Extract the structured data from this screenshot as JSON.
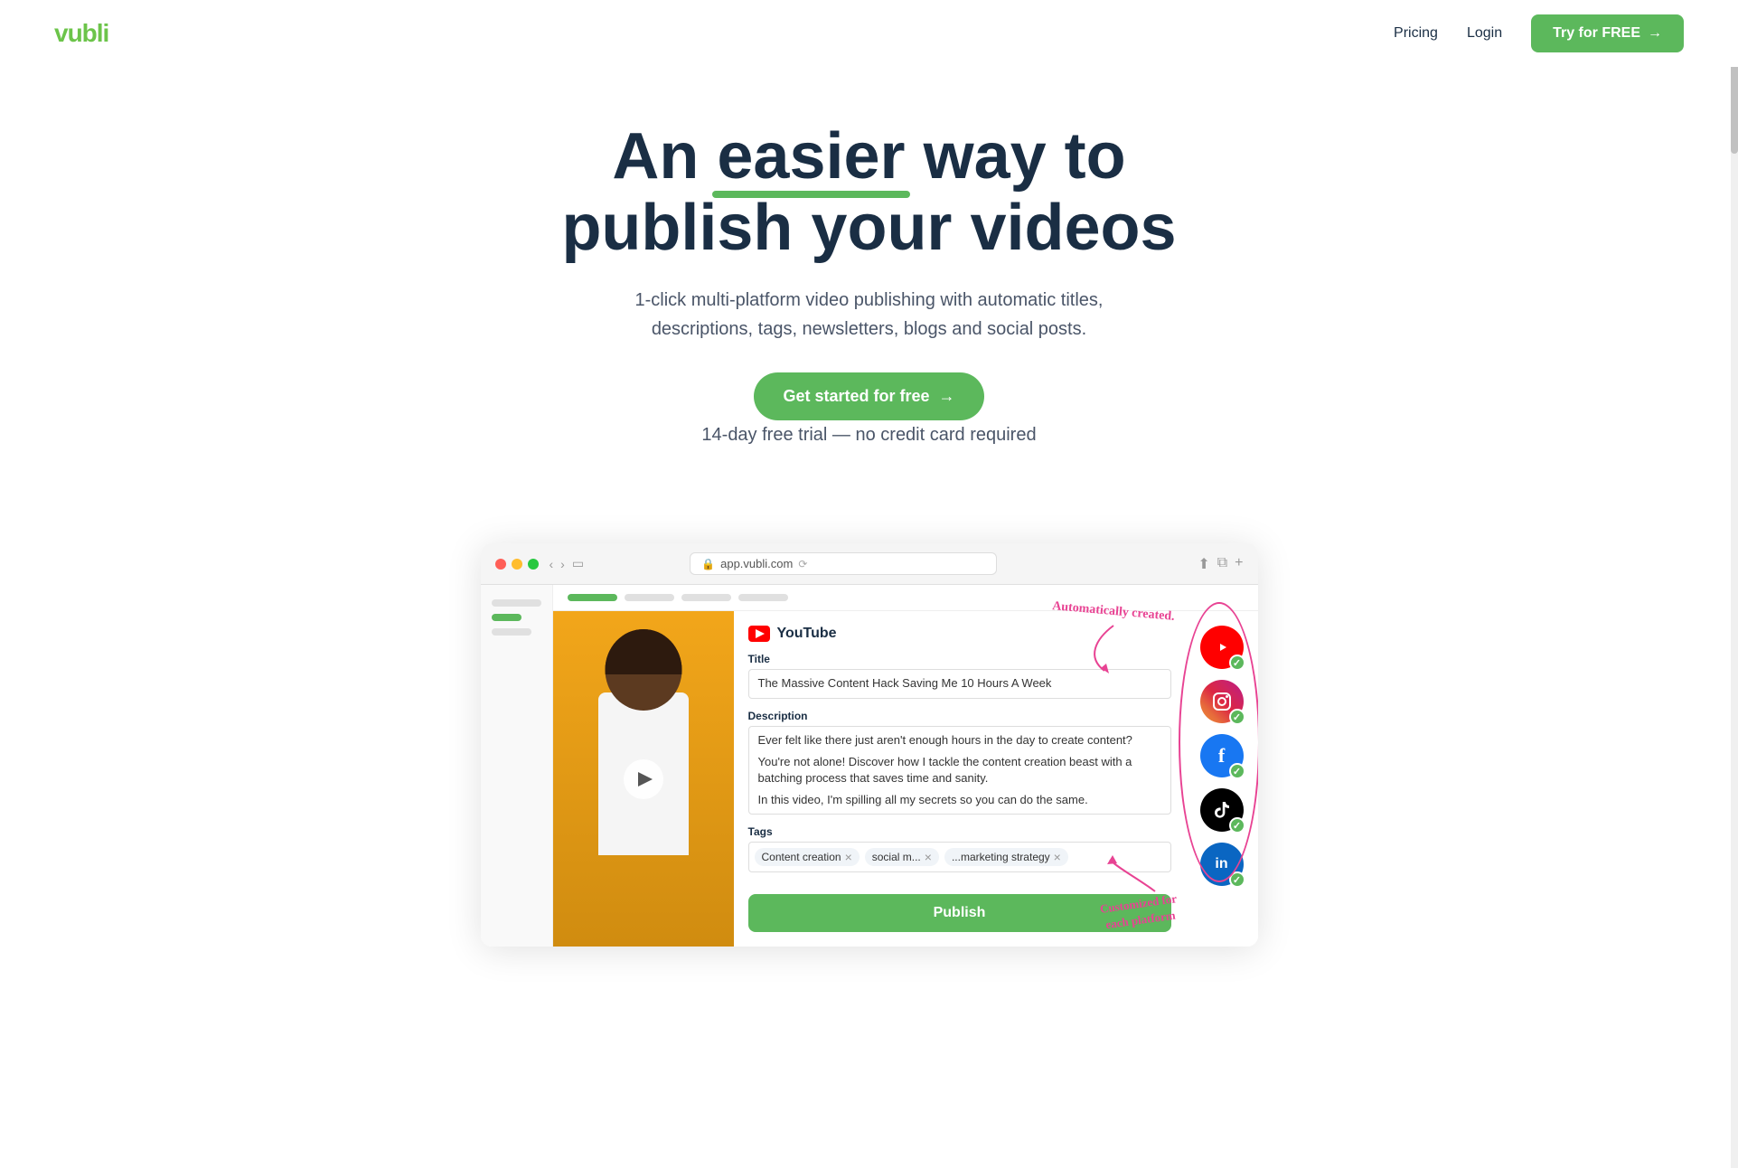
{
  "nav": {
    "logo": "vubli",
    "pricing_label": "Pricing",
    "login_label": "Login",
    "cta_label": "Try for FREE",
    "cta_arrow": "→"
  },
  "hero": {
    "headline_part1": "An",
    "headline_underline": "easier",
    "headline_part2": "way to",
    "headline_line2": "publish your videos",
    "subtext": "1-click multi-platform video publishing with automatic titles, descriptions, tags, newsletters, blogs and social posts.",
    "cta_label": "Get started for free",
    "cta_arrow": "→",
    "trial_note": "14-day free trial — no credit card required"
  },
  "browser": {
    "address": "app.vubli.com",
    "platform_label": "YouTube",
    "title_label": "Title",
    "title_value": "The Massive Content Hack Saving Me 10 Hours A Week",
    "desc_label": "Description",
    "desc_line1": "Ever felt like there just aren't enough hours in the day to create content?",
    "desc_line2": "You're not alone! Discover how I tackle the content creation beast with a batching process that saves time and sanity.",
    "desc_line3": "In this video, I'm spilling all my secrets so you can do the same.",
    "tags_label": "Tags",
    "tags": [
      "Content creation",
      "social m...",
      "...marketing strategy"
    ],
    "publish_label": "Publish"
  },
  "annotations": {
    "auto_created": "Automatically\ncreated.",
    "customized": "Customized for\neach platform"
  },
  "platforms": [
    {
      "name": "YouTube",
      "class": "pi-youtube",
      "icon": "▶",
      "color": "#ff0000"
    },
    {
      "name": "Instagram",
      "class": "pi-instagram",
      "icon": "📷",
      "color": "#e1306c"
    },
    {
      "name": "Facebook",
      "class": "pi-facebook",
      "icon": "f",
      "color": "#1877f2"
    },
    {
      "name": "TikTok",
      "class": "pi-tiktok",
      "icon": "♪",
      "color": "#000"
    },
    {
      "name": "LinkedIn",
      "class": "pi-linkedin",
      "icon": "in",
      "color": "#0a66c2"
    }
  ]
}
